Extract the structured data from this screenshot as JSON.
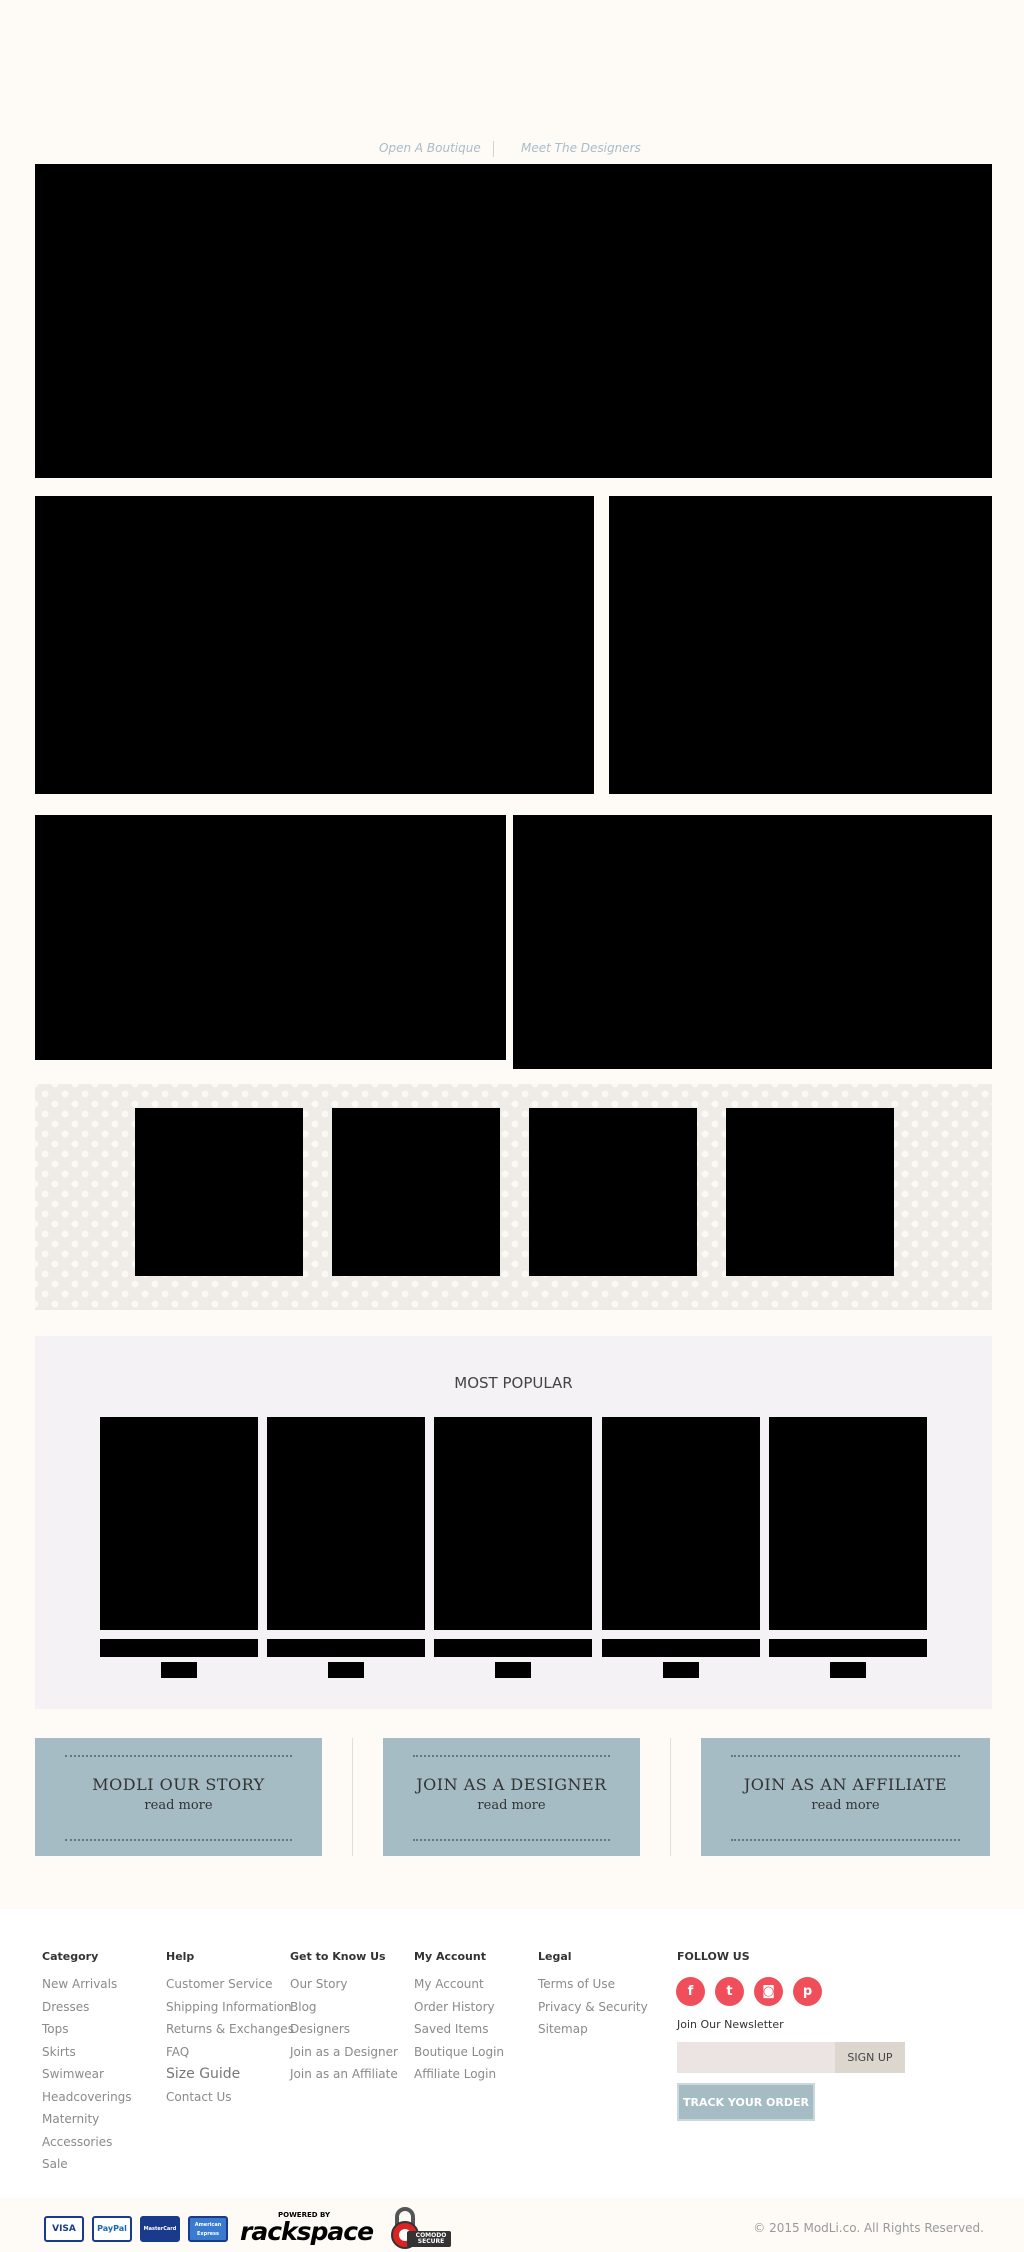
{
  "top_links": [
    "Open A Boutique",
    "Meet The Designers"
  ],
  "most_popular": {
    "title": "MOST POPULAR"
  },
  "cards": [
    {
      "title": "MODLI OUR STORY",
      "link": "read more"
    },
    {
      "title": "JOIN AS A DESIGNER",
      "link": "read more"
    },
    {
      "title": "JOIN AS AN AFFILIATE",
      "link": "read more"
    }
  ],
  "footer": {
    "category": {
      "title": "Category",
      "items": [
        "New Arrivals",
        "Dresses",
        "Tops",
        "Skirts",
        "Swimwear",
        "Headcoverings",
        "Maternity",
        "Accessories",
        "Sale"
      ]
    },
    "help": {
      "title": "Help",
      "items": [
        "Customer Service",
        "Shipping Information",
        "Returns & Exchanges",
        "FAQ",
        "Size Guide",
        "Contact Us"
      ]
    },
    "know": {
      "title": "Get to Know Us",
      "items": [
        "Our Story",
        "Blog",
        "Designers",
        "Join as a Designer",
        "Join as an Affiliate"
      ]
    },
    "account": {
      "title": "My Account",
      "items": [
        "My Account",
        "Order History",
        "Saved Items",
        "Boutique Login",
        "Affiliate Login"
      ]
    },
    "legal": {
      "title": "Legal",
      "items": [
        "Terms of Use",
        "Privacy & Security",
        "Sitemap"
      ]
    },
    "follow": {
      "title": "FOLLOW US",
      "icons": [
        "facebook-icon",
        "twitter-icon",
        "instagram-icon",
        "pinterest-icon"
      ]
    },
    "newsletter_label": "Join Our Newsletter",
    "signup": "SIGN UP",
    "track": "TRACK YOUR ORDER",
    "payments": [
      "VISA",
      "PayPal",
      "MasterCard",
      "American Express"
    ],
    "powered_by": "POWERED BY",
    "rackspace": "rackspace",
    "comodo": "COMODO SECURE",
    "copyright": "© 2015 ModLi.co. All Rights Reserved."
  },
  "colors": {
    "accent": "#f04e5a",
    "card": "#a5bcc4",
    "background": "#fefbf7"
  }
}
